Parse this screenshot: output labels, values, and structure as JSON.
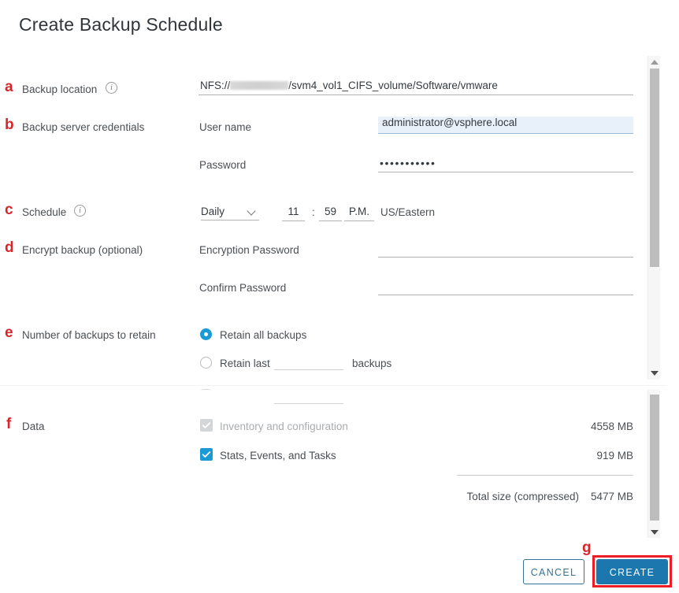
{
  "dialog": {
    "title": "Create Backup Schedule"
  },
  "annotations": {
    "a": "a",
    "b": "b",
    "c": "c",
    "d": "d",
    "e": "e",
    "f": "f",
    "g": "g"
  },
  "icons": {
    "info": "i",
    "backup_location_info": "info-icon",
    "schedule_info": "info-icon"
  },
  "fields": {
    "backup_location": {
      "label": "Backup location",
      "value": "NFS://                /svm4_vol1_CIFS_volume/Software/vmware",
      "value_prefix": "NFS://",
      "value_suffix": "/svm4_vol1_CIFS_volume/Software/vmware",
      "redacted": true
    },
    "backup_server_credentials": {
      "label": "Backup server credentials",
      "username_label": "User name",
      "username_value": "administrator@vsphere.local",
      "password_label": "Password",
      "password_value": "•••••••••••"
    },
    "schedule": {
      "label": "Schedule",
      "frequency": "Daily",
      "hour": "11",
      "colon": ":",
      "minute": "59",
      "meridiem": "P.M.",
      "timezone": "US/Eastern"
    },
    "encrypt_backup": {
      "label": "Encrypt backup (optional)",
      "encryption_password_label": "Encryption Password",
      "encryption_password_value": "",
      "confirm_password_label": "Confirm Password",
      "confirm_password_value": ""
    },
    "retention": {
      "label": "Number of backups to retain",
      "option_all": "Retain all backups",
      "option_last": "Retain last",
      "option_last_suffix": "backups",
      "retain_last_value": "",
      "selected": "all"
    },
    "data": {
      "label": "Data",
      "rows": [
        {
          "name": "Inventory and configuration",
          "size": "4558 MB",
          "checked": true,
          "disabled": true
        },
        {
          "name": "Stats, Events, and Tasks",
          "size": "919 MB",
          "checked": true,
          "disabled": false
        }
      ],
      "total_label": "Total size (compressed)",
      "total_value": "5477 MB"
    }
  },
  "footer": {
    "cancel_label": "CANCEL",
    "create_label": "CREATE"
  },
  "colors": {
    "accent_blue": "#1b9ad6",
    "button_blue": "#1c77af",
    "annotation_red": "#d9252a",
    "highlight_red": "#ee1c25",
    "cancel_border": "#31759b",
    "autofill_bg": "#e8f1fa",
    "text": "#4a4f54"
  }
}
